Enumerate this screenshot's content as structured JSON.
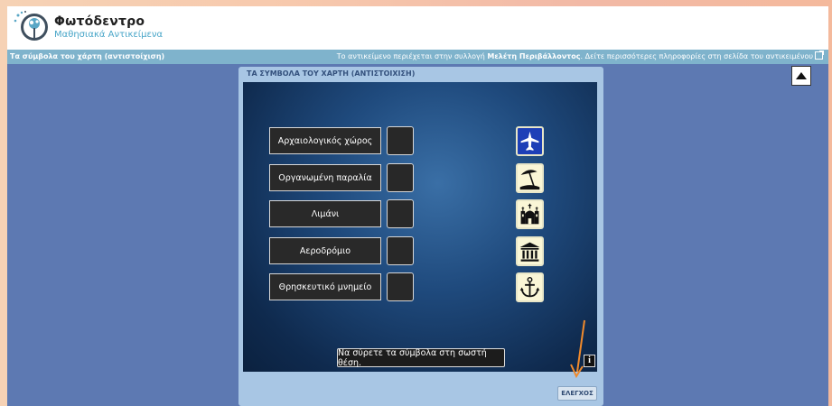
{
  "header": {
    "title": "Φωτόδεντρο",
    "subtitle": "Μαθησιακά Αντικείμενα",
    "logo_icon": "photodentro-logo-icon"
  },
  "infobar": {
    "object_title": "Τα σύμβολα του χάρτη (αντιστοίχιση)",
    "collection_text_prefix": "Το αντικείμενο περιέχεται στην συλλογή",
    "collection_name": "Μελέτη Περιβάλλοντος",
    "collection_text_suffix": ". Δείτε περισσότερες πληροφορίες στη σελίδα του αντικειμένου",
    "external_icon": "external-link-icon"
  },
  "activity": {
    "title": "ΤΑ ΣΥΜΒΟΛΑ ΤΟΥ ΧΑΡΤΗ (ΑΝΤΙΣΤΟΙΧΙΣΗ)",
    "labels": [
      "Αρχαιολογικός χώρος",
      "Οργανωμένη παραλία",
      "Λιμάνι",
      "Αεροδρόμιο",
      "Θρησκευτικό μνημείο"
    ],
    "symbols": [
      "airplane-icon",
      "beach-umbrella-icon",
      "church-icon",
      "temple-icon",
      "anchor-icon"
    ],
    "instruction": "Να σύρετε τα σύμβολα στη σωστή θέση.",
    "info_label": "i",
    "check_label": "ΕΛΕΓΧΟΣ"
  },
  "colors": {
    "page_background": "#5d79b2",
    "info_bar": "#7fb3cc",
    "panel": "#a8c6e4",
    "annotation_arrow": "#f08a2c"
  }
}
